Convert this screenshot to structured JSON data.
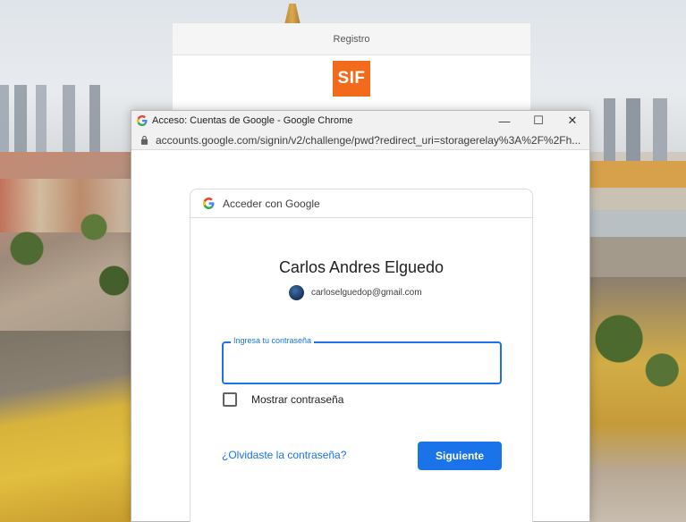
{
  "background_window": {
    "header_title": "Registro",
    "logo_text": "SIF",
    "logo_color": "#f26a1b"
  },
  "popup": {
    "window_title": "Acceso: Cuentas de Google - Google Chrome",
    "window_buttons": {
      "minimize": "—",
      "maximize": "☐",
      "close": "✕"
    },
    "url": "accounts.google.com/signin/v2/challenge/pwd?redirect_uri=storagerelay%3A%2F%2Fh...",
    "favicon": "google-g-icon",
    "lock_icon": "lock-icon"
  },
  "signin": {
    "header_label": "Acceder con Google",
    "user_name": "Carlos Andres Elguedo",
    "email": "carloselguedop@gmail.com",
    "password_field": {
      "label": "Ingresa tu contraseña",
      "value": ""
    },
    "show_password": {
      "label": "Mostrar contraseña",
      "checked": false
    },
    "forgot_link": "¿Olvidaste la contraseña?",
    "next_button": "Siguiente"
  },
  "colors": {
    "accent": "#1a73e8"
  }
}
